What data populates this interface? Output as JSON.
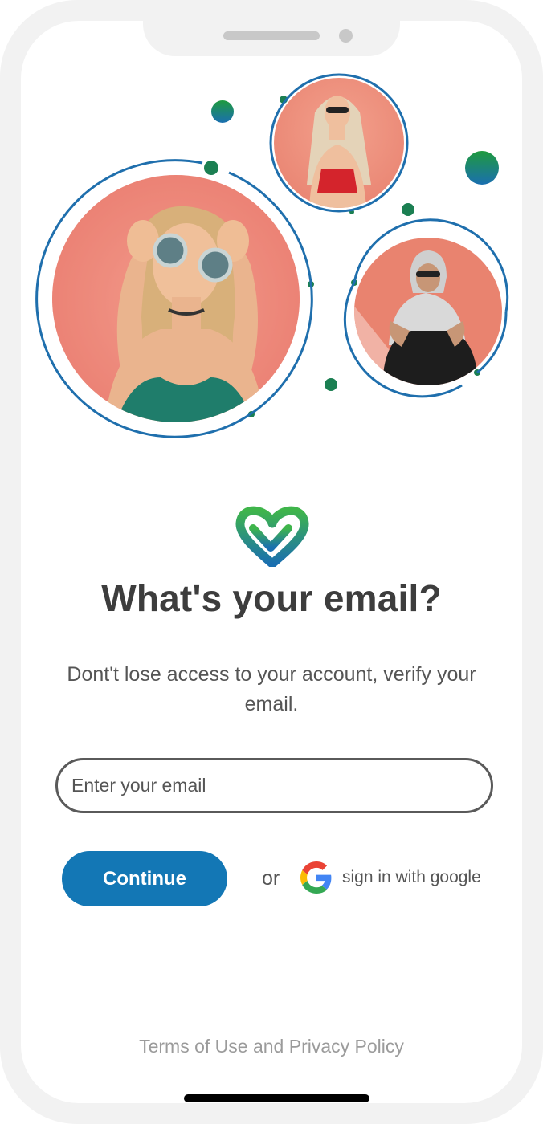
{
  "screen": {
    "title": "What's your email?",
    "subtitle": "Dont't lose access to your account, verify your email."
  },
  "email": {
    "placeholder": "Enter your email",
    "value": ""
  },
  "actions": {
    "continue_label": "Continue",
    "or_label": "or",
    "google_label": "sign in with google"
  },
  "footer": {
    "terms_label": "Terms of Use and Privacy Policy"
  },
  "icons": {
    "logo": "heart-check-logo-icon",
    "google": "google-icon"
  },
  "colors": {
    "primary": "#1377b5",
    "accent_green": "#1e9a3c",
    "ring_blue": "#1f6fad",
    "text_dark": "#3d3d3d",
    "text_muted": "#9b9b9b"
  }
}
